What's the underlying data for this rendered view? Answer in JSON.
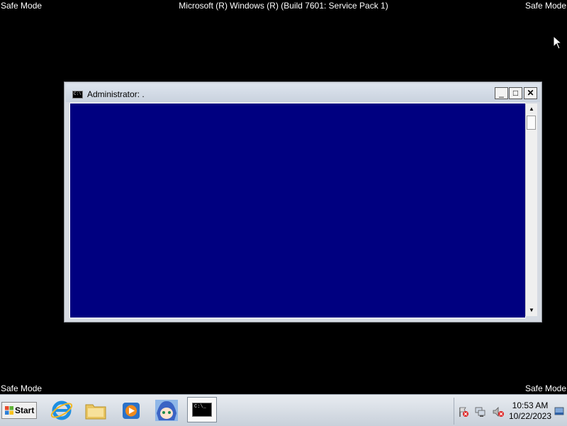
{
  "overlay": {
    "title": "Microsoft (R) Windows (R) (Build 7601: Service Pack 1)",
    "safe_mode_top_left": "Safe Mode",
    "safe_mode_top_right": "Safe Mode",
    "safe_mode_bottom_left": "Safe Mode",
    "safe_mode_bottom_right": "Safe Mode"
  },
  "window": {
    "title": "Administrator:  .",
    "icon_text": "C:\\",
    "buttons": {
      "minimize": "_",
      "maximize": "□",
      "close": "✕"
    },
    "console_background": "#000080"
  },
  "taskbar": {
    "start_label": "Start",
    "pinned": [
      "internet-explorer-icon",
      "folder-icon",
      "media-player-icon",
      "avatar-icon"
    ],
    "active_task_icon_text": "C:\\_",
    "clock": {
      "time": "10:53 AM",
      "date": "10/22/2023"
    }
  }
}
